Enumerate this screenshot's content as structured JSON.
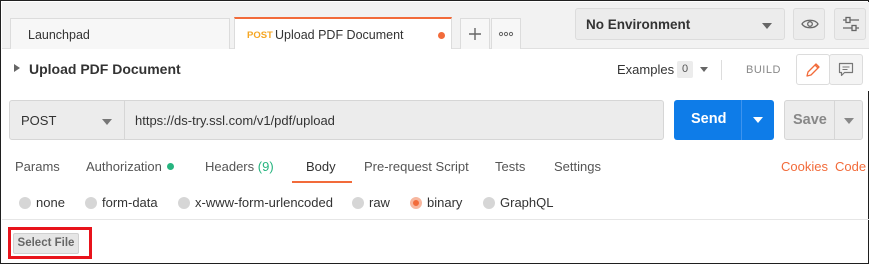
{
  "tabs": {
    "launchpad_label": "Launchpad",
    "active": {
      "method": "POST",
      "name": "Upload PDF Document",
      "unsaved": true
    },
    "new_tab_icon": "plus-icon",
    "more_icon": "more-horizontal-icon"
  },
  "environment": {
    "selected": "No Environment",
    "eye_icon": "eye-icon",
    "settings_icon": "sliders-icon"
  },
  "request": {
    "title": "Upload PDF Document",
    "examples_label": "Examples",
    "examples_count": "0",
    "build_label": "BUILD",
    "edit_icon": "pencil-icon",
    "comments_icon": "comment-icon"
  },
  "url_bar": {
    "method": "POST",
    "url": "https://ds-try.ssl.com/v1/pdf/upload",
    "send_label": "Send",
    "save_label": "Save"
  },
  "request_tabs": {
    "params": "Params",
    "authorization": "Authorization",
    "headers": "Headers",
    "headers_count": "(9)",
    "body": "Body",
    "pre_request": "Pre-request Script",
    "tests": "Tests",
    "settings": "Settings",
    "active": "Body",
    "cookies_link": "Cookies",
    "code_link": "Code"
  },
  "body_types": {
    "options": [
      "none",
      "form-data",
      "x-www-form-urlencoded",
      "raw",
      "binary",
      "GraphQL"
    ],
    "selected": "binary"
  },
  "binary": {
    "select_file_label": "Select File"
  },
  "colors": {
    "accent": "#f26b3a",
    "send_blue": "#0e7ce8",
    "status_green": "#26b47f",
    "method_post": "#f5a623",
    "highlight_red": "#e8131b"
  }
}
